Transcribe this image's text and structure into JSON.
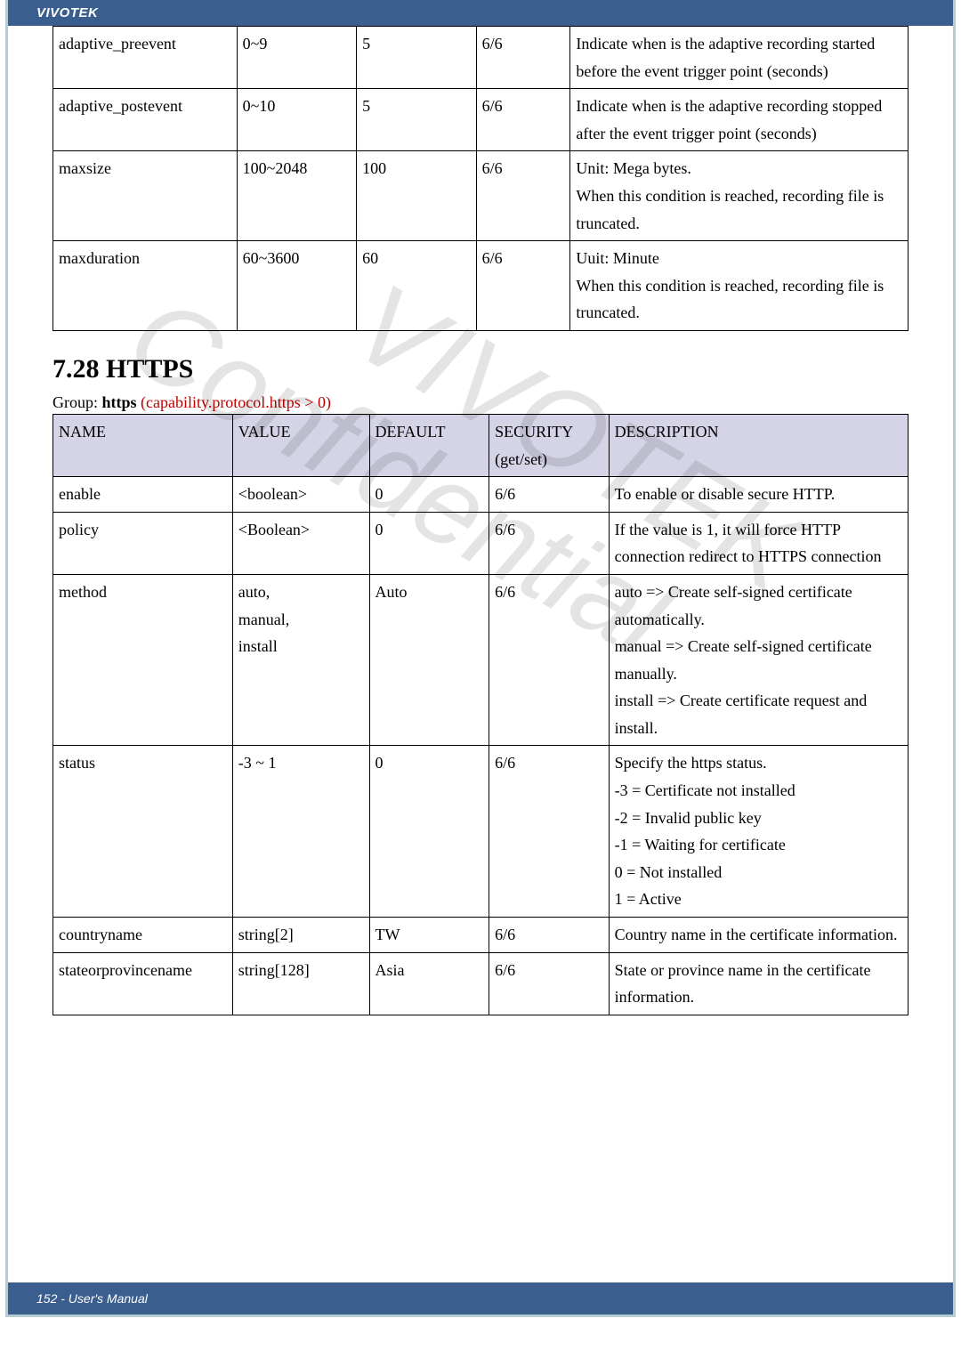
{
  "brand": "VIVOTEK",
  "footer": "152 - User's Manual",
  "table1": {
    "rows": [
      {
        "name": "adaptive_preevent",
        "value": "0~9",
        "default": "5",
        "security": "6/6",
        "desc": "Indicate when is the adaptive recording started before the event trigger point (seconds)"
      },
      {
        "name": "adaptive_postevent",
        "value": "0~10",
        "default": "5",
        "security": "6/6",
        "desc": "Indicate when is the adaptive recording stopped after the event trigger point (seconds)"
      },
      {
        "name": "maxsize",
        "value": "100~2048",
        "default": "100",
        "security": "6/6",
        "desc": "Unit: Mega bytes.\nWhen this condition is reached, recording file is truncated."
      },
      {
        "name": "maxduration",
        "value": "60~3600",
        "default": "60",
        "security": "6/6",
        "desc": "Uuit: Minute\nWhen this condition is reached, recording file is truncated."
      }
    ]
  },
  "section": {
    "title": "7.28 HTTPS"
  },
  "group_label_prefix": "Group: ",
  "group_label_main": "https",
  "group_label_red": " (capability.protocol.https > 0)",
  "table2": {
    "headers": {
      "name": "NAME",
      "value": "VALUE",
      "default": "DEFAULT",
      "security": "SECURITY",
      "sec_sub": "(get/set)",
      "desc": "DESCRIPTION"
    },
    "rows": [
      {
        "name": "enable",
        "value": "<boolean>",
        "default": "0",
        "security": "6/6",
        "desc": "To enable or disable secure HTTP."
      },
      {
        "name": "policy",
        "value": "<Boolean>",
        "default": "0",
        "security": "6/6",
        "desc": "If the value is 1, it will force HTTP connection redirect to HTTPS connection"
      },
      {
        "name": "method",
        "value": "auto,\nmanual,\ninstall",
        "default": "Auto",
        "security": "6/6",
        "desc": "auto => Create self-signed certificate automatically.\nmanual => Create self-signed certificate manually.\ninstall => Create certificate request and install."
      },
      {
        "name": "status",
        "value": "-3 ~ 1",
        "default": "0",
        "security": "6/6",
        "desc": "Specify the https status.\n-3 = Certificate not installed\n-2 = Invalid public key\n-1 = Waiting for certificate\n0 = Not installed\n1 = Active"
      },
      {
        "name": "countryname",
        "value": "string[2]",
        "default": "TW",
        "security": "6/6",
        "desc": "Country name in the certificate information."
      },
      {
        "name": "stateorprovincename",
        "value": "string[128]",
        "default": "Asia",
        "security": "6/6",
        "desc": "State or province name in the certificate information."
      }
    ]
  }
}
